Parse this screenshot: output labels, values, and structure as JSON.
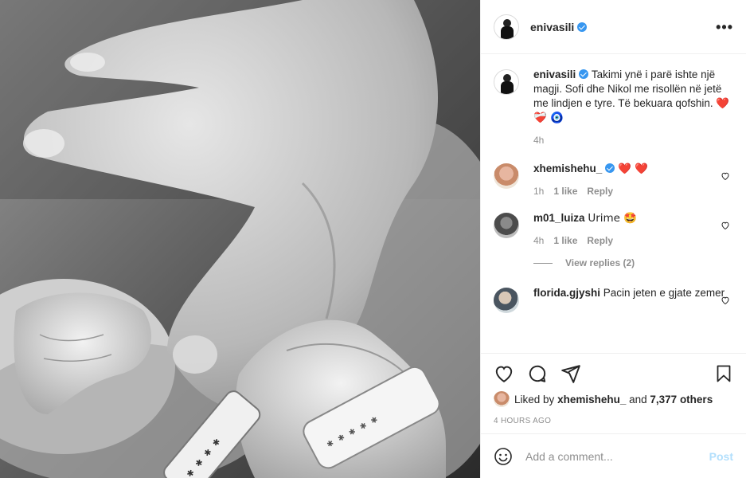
{
  "post": {
    "username": "enivasili",
    "more_label": "•••"
  },
  "caption": {
    "username": "enivasili",
    "text": "Takimi ynë i parë ishte një magji. Sofi dhe Nikol me risollën në jetë me lindjen e tyre. Të bekuara qofshin.",
    "emoji": "❤️ ❤️‍🩹 🧿",
    "time": "4h"
  },
  "comments": [
    {
      "username": "xhemishehu_",
      "verified": true,
      "text": "❤️ ❤️",
      "time": "1h",
      "likes": "1 like",
      "reply": "Reply"
    },
    {
      "username": "m01_luiza",
      "verified": false,
      "text": "Urime 🤩",
      "time": "4h",
      "likes": "1 like",
      "reply": "Reply"
    },
    {
      "username": "florida.gjyshi",
      "verified": false,
      "text": "Pacin jeten e gjate zemer"
    }
  ],
  "view_replies": "View replies (2)",
  "likes": {
    "prefix": "Liked by",
    "user": "xhemishehu_",
    "conj": "and",
    "count": "7,377 others"
  },
  "timestamp": "4 HOURS AGO",
  "add_comment": {
    "placeholder": "Add a comment...",
    "post_label": "Post"
  },
  "icons": [
    "heart-icon",
    "comment-icon",
    "share-icon",
    "bookmark-icon",
    "emoji-icon",
    "more-icon"
  ]
}
